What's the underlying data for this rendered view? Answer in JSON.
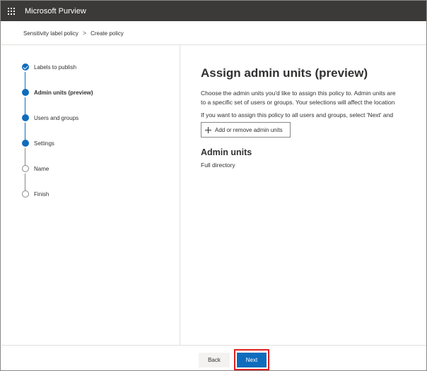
{
  "app": {
    "title": "Microsoft Purview",
    "waffle_icon": "app-launcher-icon"
  },
  "breadcrumb": {
    "items": [
      "Sensitivity label policy",
      "Create policy"
    ],
    "separator": ">"
  },
  "steps": [
    {
      "label": "Labels to publish",
      "state": "completed"
    },
    {
      "label": "Admin units (preview)",
      "state": "current"
    },
    {
      "label": "Users and groups",
      "state": "upcoming"
    },
    {
      "label": "Settings",
      "state": "upcoming"
    },
    {
      "label": "Name",
      "state": "not-started"
    },
    {
      "label": "Finish",
      "state": "not-started"
    }
  ],
  "main": {
    "title": "Assign admin units (preview)",
    "description_lines": [
      "Choose the admin units you'd like to assign this policy to. Admin units are",
      "to a specific set of users or groups. Your selections will affect the location",
      "If you want to assign this policy to all users and groups, select 'Next' and"
    ],
    "add_button": {
      "label": "Add or remove admin units",
      "icon": "plus-icon"
    },
    "section": {
      "title": "Admin units",
      "value": "Full directory"
    }
  },
  "footer": {
    "back_label": "Back",
    "next_label": "Next",
    "highlight_color": "#e02020"
  },
  "colors": {
    "topbar": "#3b3a39",
    "accent": "#0f6cbd",
    "text": "#323130"
  }
}
